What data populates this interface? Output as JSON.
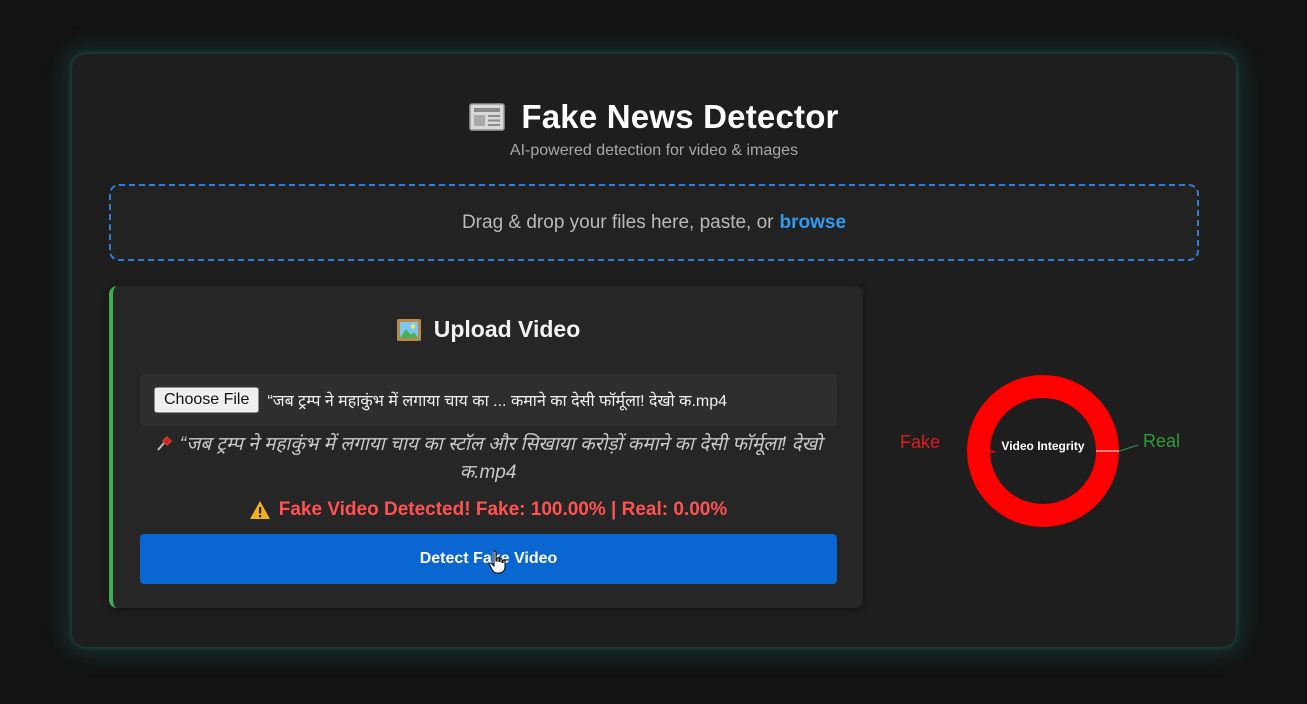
{
  "header": {
    "title": "Fake News Detector",
    "subtitle": "AI-powered detection for video & images",
    "icon": "newspaper-icon"
  },
  "drop_zone": {
    "text": "Drag & drop your files here, paste, or",
    "browse_label": "browse"
  },
  "upload_panel": {
    "title": "Upload Video",
    "icon": "framed-picture-icon",
    "choose_file_label": "Choose File",
    "selected_file_name": "“जब ट्रम्प ने महाकुंभ में लगाया चाय का ... कमाने का देसी फॉर्मूला! देखो क.mp4",
    "file_caption": "“जब ट्रम्प ने महाकुंभ में लगाया चाय का स्टॉल और सिखाया करोड़ों कमाने का देसी फॉर्मूला! देखो क.mp4",
    "result_text": "Fake Video Detected! Fake: 100.00% | Real: 0.00%",
    "detect_button_label": "Detect Fake Video"
  },
  "chart_data": {
    "type": "pie",
    "title": "Video Integrity",
    "categories": [
      "Fake",
      "Real"
    ],
    "values": [
      100,
      0
    ],
    "colors": [
      "#ff0000",
      "#2f9a3a"
    ]
  },
  "colors": {
    "accent": "#0a66d1",
    "browse_link": "#2e9cf3",
    "fake": "#ff0000",
    "real": "#2f9a3a",
    "panel_border": "#3fae52",
    "warning_text": "#ff5252"
  }
}
